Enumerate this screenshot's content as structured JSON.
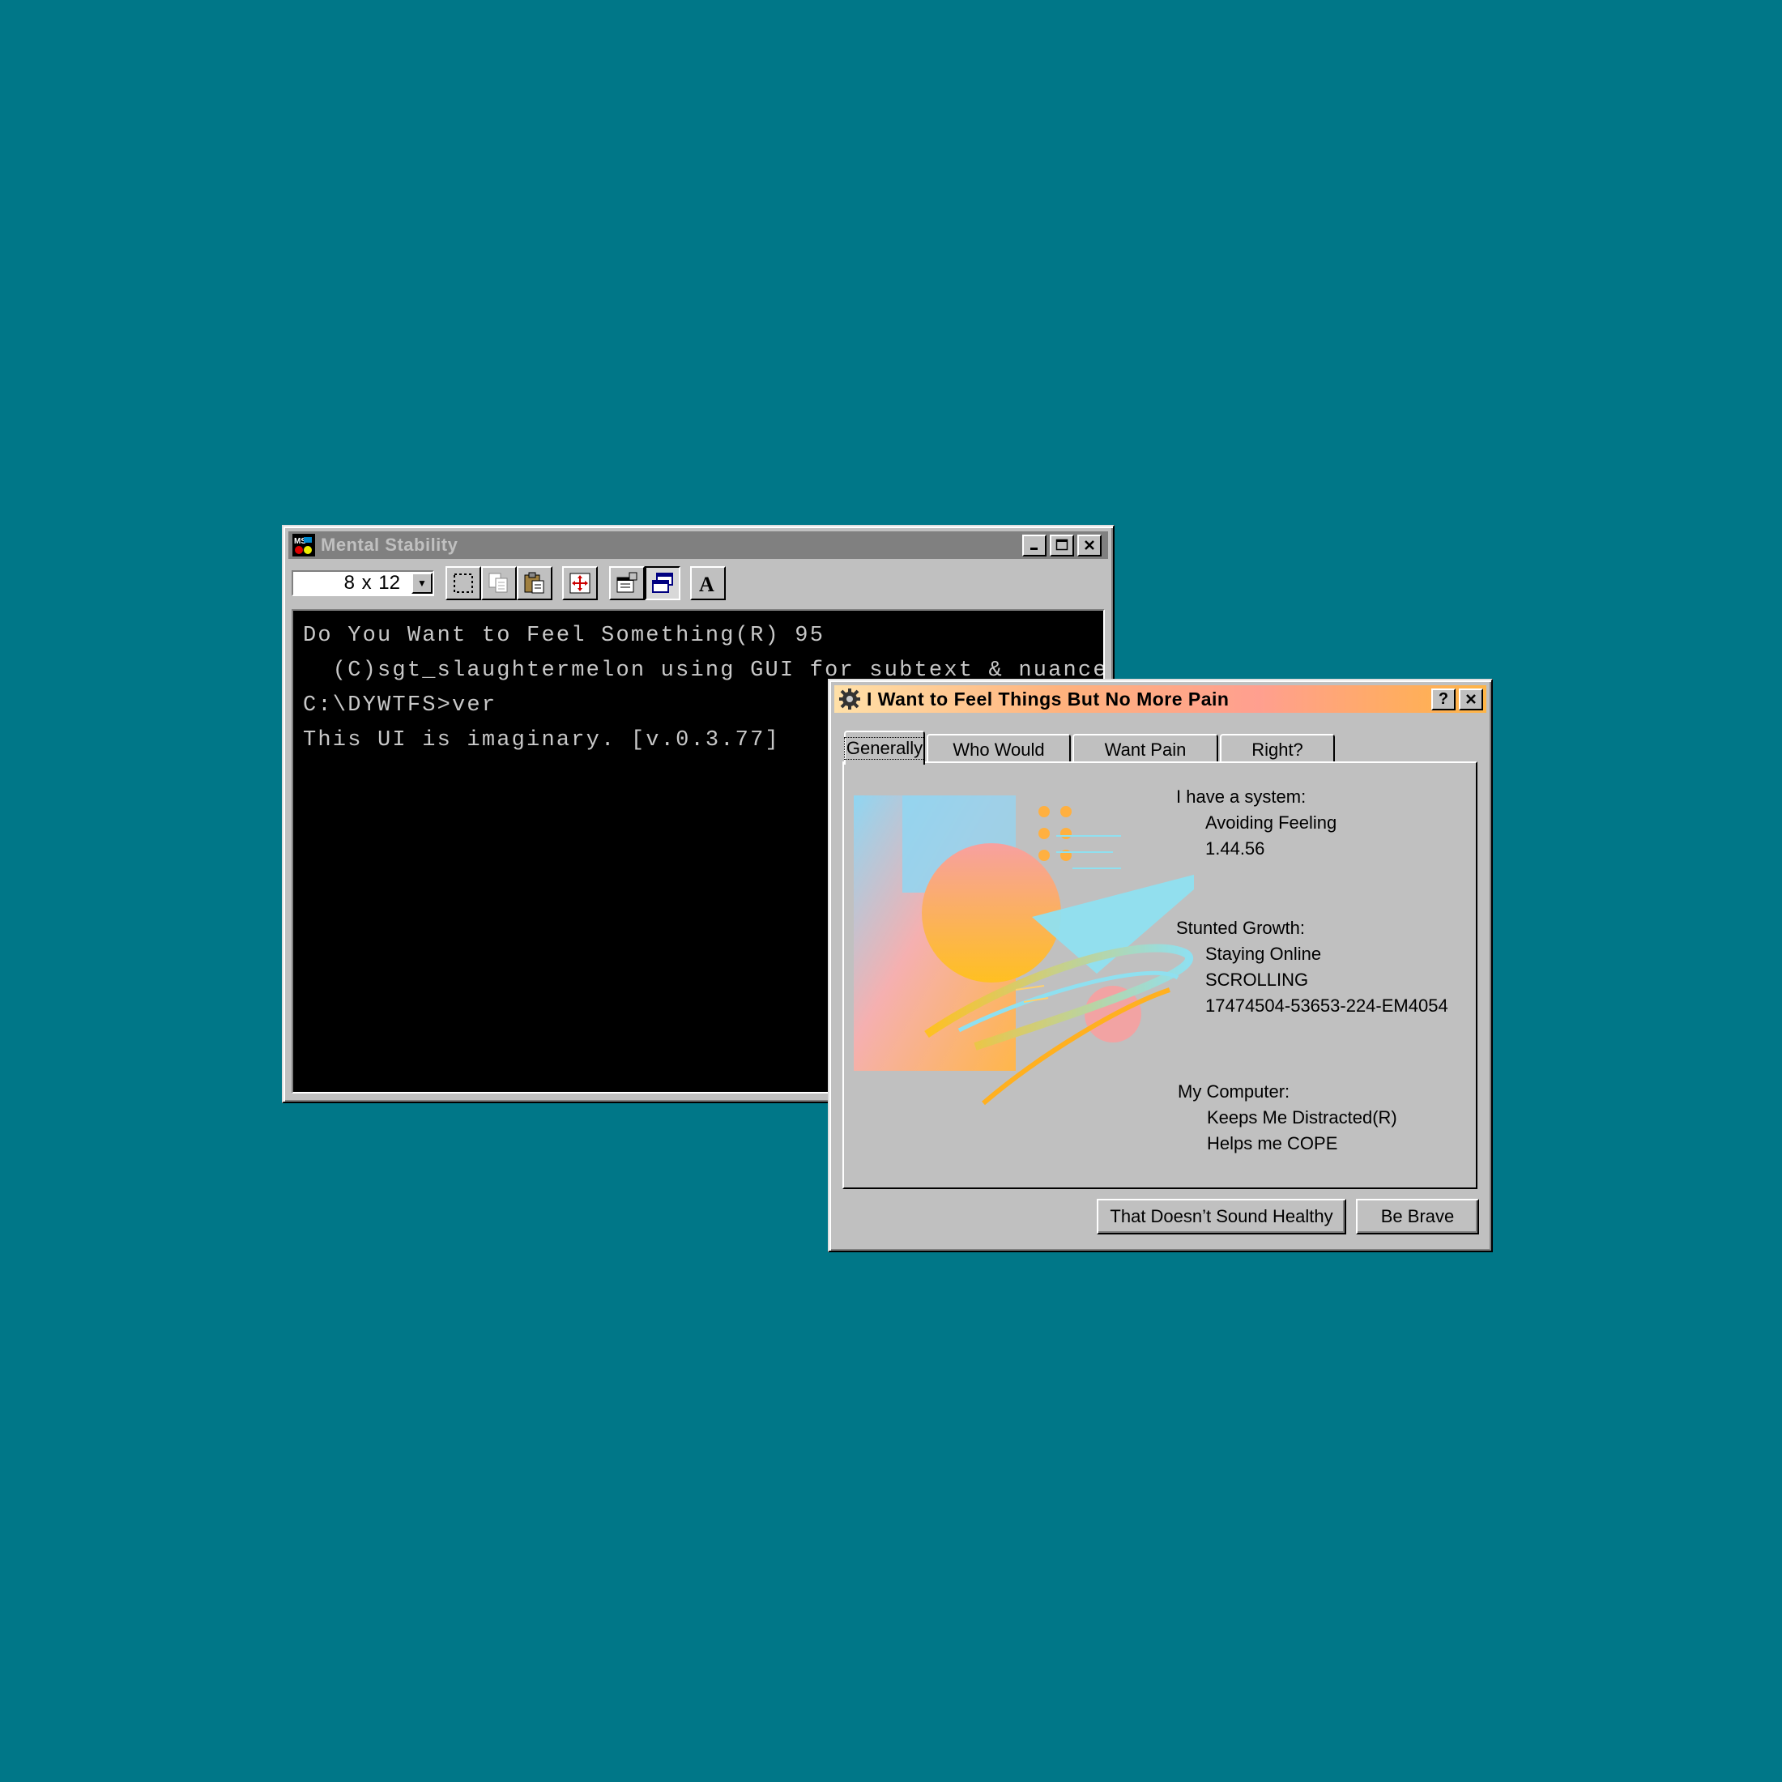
{
  "console": {
    "title": "Mental Stability",
    "font_size_value": "8 x 12",
    "lines": [
      "Do You Want to Feel Something(R) 95",
      "  (C)sgt_slaughtermelon using GUI for subtext & nuance",
      "",
      "C:\\DYWTFS>ver",
      "",
      "This UI is imaginary. [v.0.3.77]"
    ],
    "toolbar_icons": [
      "mark-icon",
      "copy-icon",
      "paste-icon",
      "fullscreen-icon",
      "properties-icon",
      "background-icon",
      "font-icon"
    ]
  },
  "dialog": {
    "title": "I Want to Feel Things But No More Pain",
    "help_label": "?",
    "tabs": [
      "Generally",
      "Who Would",
      "Want Pain",
      "Right?"
    ],
    "sections": {
      "system_heading": "I have a system:",
      "system_line1": "Avoiding Feeling",
      "system_line2": "1.44.56",
      "growth_heading": "Stunted Growth:",
      "growth_line1": "Staying Online",
      "growth_line2": "SCROLLING",
      "growth_line3": "17474504-53653-224-EM4054",
      "computer_heading": "My Computer:",
      "computer_line1": "Keeps Me Distracted(R)",
      "computer_line2": "Helps me COPE"
    },
    "buttons": {
      "unhealthy": "That Doesn’t Sound Healthy",
      "brave": "Be Brave"
    }
  },
  "colors": {
    "desktop": "#007788",
    "window_face": "#c0c0c0",
    "inactive_titlebar": "#808080",
    "terminal_bg": "#000000",
    "terminal_fg": "#c8c8c8"
  }
}
